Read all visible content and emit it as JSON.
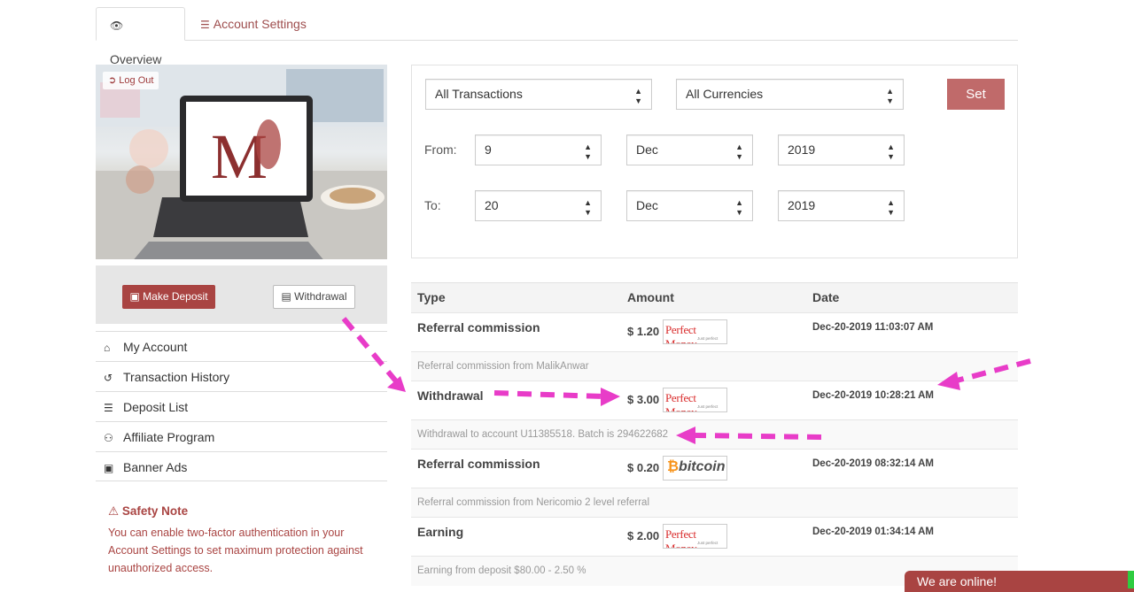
{
  "tabs": [
    {
      "label": "Overview",
      "icon": "eye-icon"
    },
    {
      "label": "Account Settings",
      "icon": "sliders-icon"
    }
  ],
  "sidebar": {
    "logout_label": "Log Out",
    "make_deposit_label": "Make Deposit",
    "withdrawal_label": "Withdrawal",
    "menu": [
      {
        "label": "My Account",
        "icon": "home-icon"
      },
      {
        "label": "Transaction History",
        "icon": "history-icon"
      },
      {
        "label": "Deposit List",
        "icon": "list-icon"
      },
      {
        "label": "Affiliate Program",
        "icon": "users-icon"
      },
      {
        "label": "Banner Ads",
        "icon": "image-icon"
      }
    ],
    "safety_title": "Safety Note",
    "safety_text": "You can enable two-factor authentication in your Account Settings to set maximum protection against unauthorized access."
  },
  "filter": {
    "type": "All Transactions",
    "currency": "All Currencies",
    "set_label": "Set",
    "from_label": "From:",
    "to_label": "To:",
    "from": {
      "day": "9",
      "month": "Dec",
      "year": "2019"
    },
    "to": {
      "day": "20",
      "month": "Dec",
      "year": "2019"
    }
  },
  "table": {
    "headers": {
      "type": "Type",
      "amount": "Amount",
      "date": "Date"
    },
    "rows": [
      {
        "type": "Referral commission",
        "amount": "$ 1.20",
        "processor": "Perfect Money",
        "date": "Dec-20-2019 11:03:07 AM",
        "description": "Referral commission from MalikAnwar"
      },
      {
        "type": "Withdrawal",
        "amount": "$ 3.00",
        "processor": "Perfect Money",
        "date": "Dec-20-2019 10:28:21 AM",
        "description": "Withdrawal to account U11385518. Batch is 294622682"
      },
      {
        "type": "Referral commission",
        "amount": "$ 0.20",
        "processor": "bitcoin",
        "date": "Dec-20-2019 08:32:14 AM",
        "description": "Referral commission from Nericomio 2 level referral"
      },
      {
        "type": "Earning",
        "amount": "$ 2.00",
        "processor": "Perfect Money",
        "date": "Dec-20-2019 01:34:14 AM",
        "description": "Earning from deposit $80.00 - 2.50 %"
      }
    ]
  },
  "processor_logos": {
    "perfect_money": "Perfect Money",
    "perfect_money_sub": "Just perfect",
    "bitcoin": "bitcoin"
  },
  "chat": {
    "label": "We are online!"
  },
  "colors": {
    "accent": "#a94442",
    "arrow": "#e83cc8",
    "set_button": "#c06a6a"
  }
}
